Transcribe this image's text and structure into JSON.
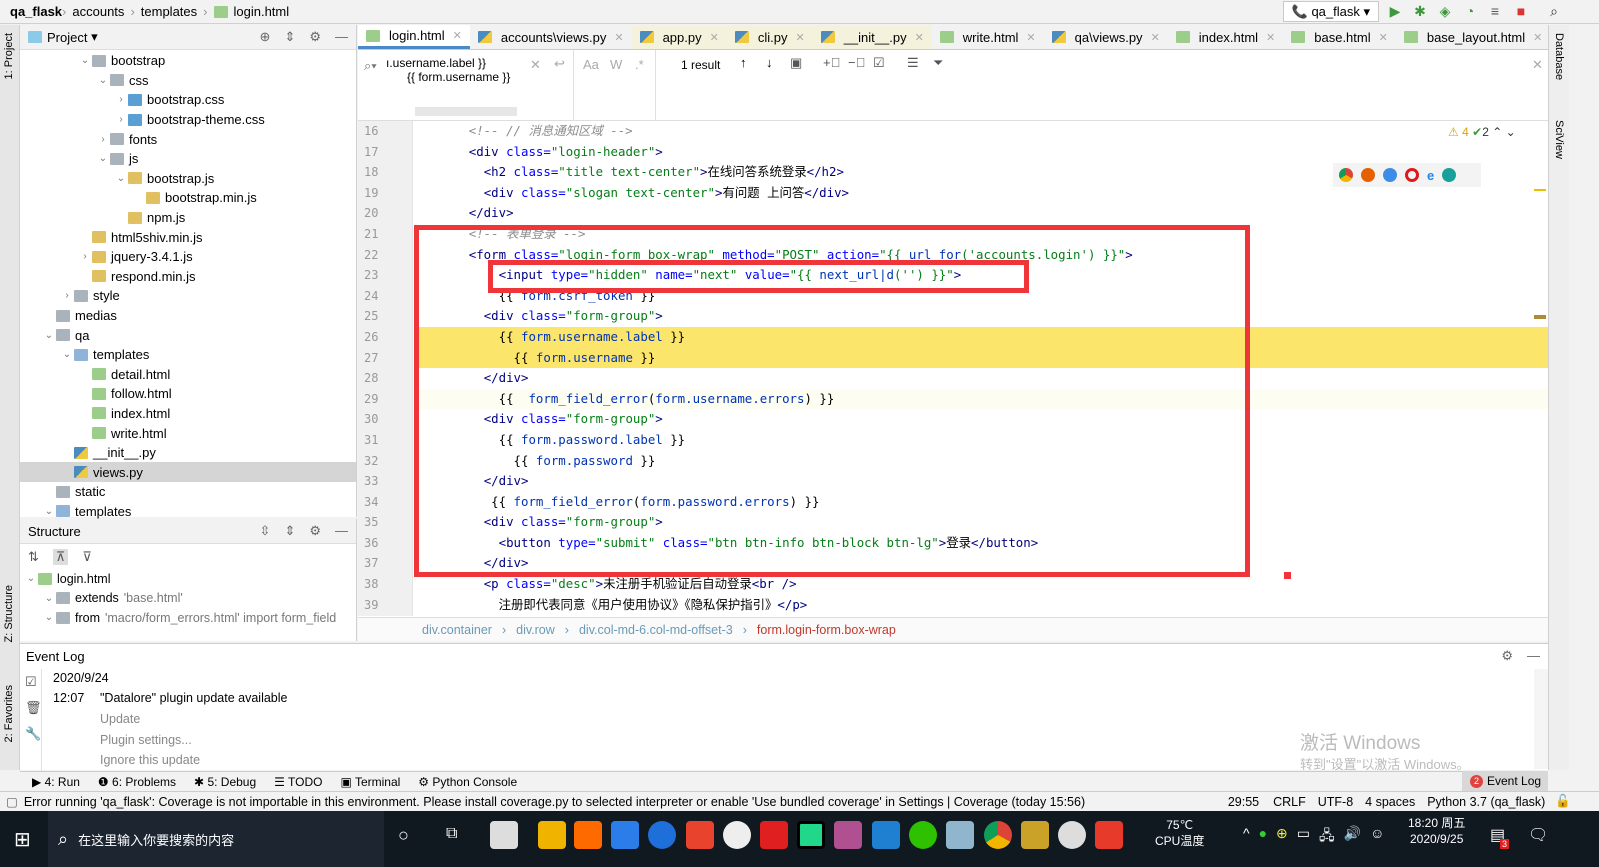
{
  "navbar": {
    "crumbs": [
      "qa_flask",
      "accounts",
      "templates",
      "login.html"
    ],
    "run_config": "qa_flask"
  },
  "left_strip": {
    "project": "1: Project",
    "structure": "Z: Structure",
    "favorites": "2: Favorites"
  },
  "right_strip": {
    "database": "Database",
    "sciview": "SciView"
  },
  "project": {
    "title": "Project",
    "tree": [
      {
        "label": "bootstrap",
        "type": "folder",
        "level": 3,
        "arrow": "down"
      },
      {
        "label": "css",
        "type": "folder",
        "level": 4,
        "arrow": "down"
      },
      {
        "label": "bootstrap.css",
        "type": "css",
        "level": 5,
        "arrow": "right"
      },
      {
        "label": "bootstrap-theme.css",
        "type": "css",
        "level": 5,
        "arrow": "right"
      },
      {
        "label": "fonts",
        "type": "folder",
        "level": 4,
        "arrow": "right"
      },
      {
        "label": "js",
        "type": "folder",
        "level": 4,
        "arrow": "down"
      },
      {
        "label": "bootstrap.js",
        "type": "js",
        "level": 5,
        "arrow": "down"
      },
      {
        "label": "bootstrap.min.js",
        "type": "js",
        "level": 6,
        "arrow": ""
      },
      {
        "label": "npm.js",
        "type": "js",
        "level": 5,
        "arrow": ""
      },
      {
        "label": "html5shiv.min.js",
        "type": "js",
        "level": 3,
        "arrow": ""
      },
      {
        "label": "jquery-3.4.1.js",
        "type": "js",
        "level": 3,
        "arrow": "right"
      },
      {
        "label": "respond.min.js",
        "type": "js",
        "level": 3,
        "arrow": ""
      },
      {
        "label": "style",
        "type": "folder",
        "level": 2,
        "arrow": "right"
      },
      {
        "label": "medias",
        "type": "folder",
        "level": 1,
        "arrow": ""
      },
      {
        "label": "qa",
        "type": "folder",
        "level": 1,
        "arrow": "down"
      },
      {
        "label": "templates",
        "type": "folder-blue",
        "level": 2,
        "arrow": "down"
      },
      {
        "label": "detail.html",
        "type": "html",
        "level": 3,
        "arrow": ""
      },
      {
        "label": "follow.html",
        "type": "html",
        "level": 3,
        "arrow": ""
      },
      {
        "label": "index.html",
        "type": "html",
        "level": 3,
        "arrow": ""
      },
      {
        "label": "write.html",
        "type": "html",
        "level": 3,
        "arrow": ""
      },
      {
        "label": "__init__.py",
        "type": "py",
        "level": 2,
        "arrow": ""
      },
      {
        "label": "views.py",
        "type": "py",
        "level": 2,
        "arrow": "",
        "selected": true
      },
      {
        "label": "static",
        "type": "folder",
        "level": 1,
        "arrow": ""
      },
      {
        "label": "templates",
        "type": "folder-blue",
        "level": 1,
        "arrow": "down"
      }
    ]
  },
  "structure": {
    "title": "Structure",
    "items": [
      {
        "label": "login.html",
        "level": 0
      },
      {
        "label": "extends",
        "extra": "'base.html'",
        "level": 1
      },
      {
        "label": "from",
        "extra": "'macro/form_errors.html' import form_field",
        "level": 1
      }
    ]
  },
  "editor": {
    "tabs": [
      {
        "label": "login.html",
        "icon": "html",
        "active": true
      },
      {
        "label": "accounts\\views.py",
        "icon": "py"
      },
      {
        "label": "app.py",
        "icon": "py",
        "tinted": true
      },
      {
        "label": "cli.py",
        "icon": "py",
        "tinted": true
      },
      {
        "label": "__init__.py",
        "icon": "py",
        "tinted": true
      },
      {
        "label": "write.html",
        "icon": "html"
      },
      {
        "label": "qa\\views.py",
        "icon": "py"
      },
      {
        "label": "index.html",
        "icon": "html"
      },
      {
        "label": "base.html",
        "icon": "html"
      },
      {
        "label": "base_layout.html",
        "icon": "html"
      }
    ],
    "search": {
      "line1": "ı.username.label }}",
      "line2": "{{ form.username }}",
      "match_case": "Aa",
      "words": "W",
      "regex": ".*",
      "result": "1 result"
    },
    "inspections": {
      "warnings": "4",
      "ok": "2"
    },
    "lines": [
      {
        "n": "16",
        "t": [
          [
            "      ",
            "t-txt"
          ],
          [
            "<!-- // 消息通知区域 -->",
            "t-com"
          ]
        ]
      },
      {
        "n": "17",
        "t": [
          [
            "      ",
            "t-txt"
          ],
          [
            "<div ",
            "t-tag"
          ],
          [
            "class=",
            "t-attr"
          ],
          [
            "\"login-header\"",
            "t-str"
          ],
          [
            ">",
            "t-tag"
          ]
        ]
      },
      {
        "n": "18",
        "t": [
          [
            "        ",
            "t-txt"
          ],
          [
            "<h2 ",
            "t-tag"
          ],
          [
            "class=",
            "t-attr"
          ],
          [
            "\"title text-center\"",
            "t-str"
          ],
          [
            ">",
            "t-tag"
          ],
          [
            "在线问答系统登录",
            "t-txt"
          ],
          [
            "</h2>",
            "t-tag"
          ]
        ]
      },
      {
        "n": "19",
        "t": [
          [
            "        ",
            "t-txt"
          ],
          [
            "<div ",
            "t-tag"
          ],
          [
            "class=",
            "t-attr"
          ],
          [
            "\"slogan text-center\"",
            "t-str"
          ],
          [
            ">",
            "t-tag"
          ],
          [
            "有问题 上问答",
            "t-txt"
          ],
          [
            "</div>",
            "t-tag"
          ]
        ]
      },
      {
        "n": "20",
        "t": [
          [
            "      ",
            "t-txt"
          ],
          [
            "</div>",
            "t-tag"
          ]
        ]
      },
      {
        "n": "21",
        "t": [
          [
            "      ",
            "t-txt"
          ],
          [
            "<!-- 表单登录 -->",
            "t-com"
          ]
        ]
      },
      {
        "n": "22",
        "t": [
          [
            "      ",
            "t-txt"
          ],
          [
            "<form ",
            "t-tag"
          ],
          [
            "class=",
            "t-attr"
          ],
          [
            "\"login-form box-wrap\" ",
            "t-str"
          ],
          [
            "method=",
            "t-attr"
          ],
          [
            "\"POST\" ",
            "t-str"
          ],
          [
            "action=",
            "t-attr"
          ],
          [
            "\"{{ ",
            "t-str"
          ],
          [
            "url_for",
            "t-var"
          ],
          [
            "('accounts.login') }}\"",
            "t-str"
          ],
          [
            ">",
            "t-tag"
          ]
        ]
      },
      {
        "n": "23",
        "t": [
          [
            "          ",
            "t-txt"
          ],
          [
            "<input ",
            "t-tag"
          ],
          [
            "type=",
            "t-attr"
          ],
          [
            "\"hidden\" ",
            "t-str"
          ],
          [
            "name=",
            "t-attr"
          ],
          [
            "\"next\" ",
            "t-str"
          ],
          [
            "value=",
            "t-attr"
          ],
          [
            "\"{{ ",
            "t-str"
          ],
          [
            "next_url|d",
            "t-var"
          ],
          [
            "('') }}\"",
            "t-str"
          ],
          [
            ">",
            "t-tag"
          ]
        ]
      },
      {
        "n": "24",
        "t": [
          [
            "          ",
            "t-txt"
          ],
          [
            "{{ ",
            "t-txt"
          ],
          [
            "form.csrf_token",
            "t-var"
          ],
          [
            " }}",
            "t-txt"
          ]
        ]
      },
      {
        "n": "25",
        "t": [
          [
            "        ",
            "t-txt"
          ],
          [
            "<div ",
            "t-tag"
          ],
          [
            "class=",
            "t-attr"
          ],
          [
            "\"form-group\"",
            "t-str"
          ],
          [
            ">",
            "t-tag"
          ]
        ]
      },
      {
        "n": "26",
        "hl": true,
        "t": [
          [
            "          ",
            "t-txt"
          ],
          [
            "{{ ",
            "t-txt"
          ],
          [
            "form.username.label",
            "t-var"
          ],
          [
            " }}",
            "t-txt"
          ]
        ]
      },
      {
        "n": "27",
        "hl": true,
        "t": [
          [
            "            ",
            "t-txt"
          ],
          [
            "{{ ",
            "t-txt"
          ],
          [
            "form.username",
            "t-var"
          ],
          [
            " }}",
            "t-txt"
          ]
        ]
      },
      {
        "n": "28",
        "t": [
          [
            "        ",
            "t-txt"
          ],
          [
            "</div>",
            "t-tag"
          ]
        ]
      },
      {
        "n": "29",
        "cur": true,
        "t": [
          [
            "          ",
            "t-txt"
          ],
          [
            "{{  ",
            "t-txt"
          ],
          [
            "form_field_error",
            "t-var"
          ],
          [
            "(",
            "t-txt"
          ],
          [
            "form.username.errors",
            "t-var"
          ],
          [
            ") }}",
            "t-txt"
          ]
        ]
      },
      {
        "n": "30",
        "t": [
          [
            "        ",
            "t-txt"
          ],
          [
            "<div ",
            "t-tag"
          ],
          [
            "class=",
            "t-attr"
          ],
          [
            "\"form-group\"",
            "t-str"
          ],
          [
            ">",
            "t-tag"
          ]
        ]
      },
      {
        "n": "31",
        "t": [
          [
            "          ",
            "t-txt"
          ],
          [
            "{{ ",
            "t-txt"
          ],
          [
            "form.password.label",
            "t-var"
          ],
          [
            " }}",
            "t-txt"
          ]
        ]
      },
      {
        "n": "32",
        "t": [
          [
            "            ",
            "t-txt"
          ],
          [
            "{{ ",
            "t-txt"
          ],
          [
            "form.password",
            "t-var"
          ],
          [
            " }}",
            "t-txt"
          ]
        ]
      },
      {
        "n": "33",
        "t": [
          [
            "        ",
            "t-txt"
          ],
          [
            "</div>",
            "t-tag"
          ]
        ]
      },
      {
        "n": "34",
        "t": [
          [
            "         ",
            "t-txt"
          ],
          [
            "{{ ",
            "t-txt"
          ],
          [
            "form_field_error",
            "t-var"
          ],
          [
            "(",
            "t-txt"
          ],
          [
            "form.password.errors",
            "t-var"
          ],
          [
            ") }}",
            "t-txt"
          ]
        ]
      },
      {
        "n": "35",
        "t": [
          [
            "        ",
            "t-txt"
          ],
          [
            "<div ",
            "t-tag"
          ],
          [
            "class=",
            "t-attr"
          ],
          [
            "\"form-group\"",
            "t-str"
          ],
          [
            ">",
            "t-tag"
          ]
        ]
      },
      {
        "n": "36",
        "t": [
          [
            "          ",
            "t-txt"
          ],
          [
            "<button ",
            "t-tag"
          ],
          [
            "type=",
            "t-attr"
          ],
          [
            "\"submit\" ",
            "t-str"
          ],
          [
            "class=",
            "t-attr"
          ],
          [
            "\"btn btn-info btn-block btn-lg\"",
            "t-str"
          ],
          [
            ">",
            "t-tag"
          ],
          [
            "登录",
            "t-txt"
          ],
          [
            "</button>",
            "t-tag"
          ]
        ]
      },
      {
        "n": "37",
        "t": [
          [
            "        ",
            "t-txt"
          ],
          [
            "</div>",
            "t-tag"
          ]
        ]
      },
      {
        "n": "38",
        "t": [
          [
            "        ",
            "t-txt"
          ],
          [
            "<p ",
            "t-tag"
          ],
          [
            "class=",
            "t-attr"
          ],
          [
            "\"desc\"",
            "t-str"
          ],
          [
            ">",
            "t-tag"
          ],
          [
            "未注册手机验证后自动登录",
            "t-txt"
          ],
          [
            "<br />",
            "t-tag"
          ]
        ]
      },
      {
        "n": "39",
        "t": [
          [
            "          ",
            "t-txt"
          ],
          [
            "注册即代表同意《用户使用协议》《隐私保护指引》",
            "t-txt"
          ],
          [
            "</p>",
            "t-tag"
          ]
        ]
      }
    ],
    "breadcrumb": [
      "div.container",
      "div.row",
      "div.col-md-6.col-md-offset-3",
      "form.login-form.box-wrap"
    ]
  },
  "event_log": {
    "title": "Event Log",
    "date": "2020/9/24",
    "time": "12:07",
    "message": "\"Datalore\" plugin update available",
    "links": [
      "Update",
      "Plugin settings...",
      "Ignore this update"
    ]
  },
  "watermark": {
    "line1": "激活 Windows",
    "line2": "转到\"设置\"以激活 Windows。"
  },
  "tool_windows": [
    {
      "label": "4: Run"
    },
    {
      "label": "6: Problems"
    },
    {
      "label": "5: Debug"
    },
    {
      "label": "TODO"
    },
    {
      "label": "Terminal"
    },
    {
      "label": "Python Console"
    }
  ],
  "event_log_button": {
    "label": "Event Log",
    "count": "2"
  },
  "status": {
    "message": "Error running 'qa_flask': Coverage is not importable in this environment. Please install coverage.py to selected interpreter or enable 'Use bundled coverage' in Settings | Coverage (today 15:56)",
    "position": "29:55",
    "line_sep": "CRLF",
    "encoding": "UTF-8",
    "indent": "4 spaces",
    "interpreter": "Python 3.7 (qa_flask)"
  },
  "taskbar": {
    "search_placeholder": "在这里输入你要搜索的内容",
    "temp": "75℃",
    "temp_label": "CPU温度",
    "time": "18:20 周五",
    "date": "2020/9/25",
    "notif_count": "3"
  },
  "colors": {
    "highlight_box": "#f0353a",
    "search_match": "#fce56b",
    "active_tab": "#4a88c7"
  }
}
